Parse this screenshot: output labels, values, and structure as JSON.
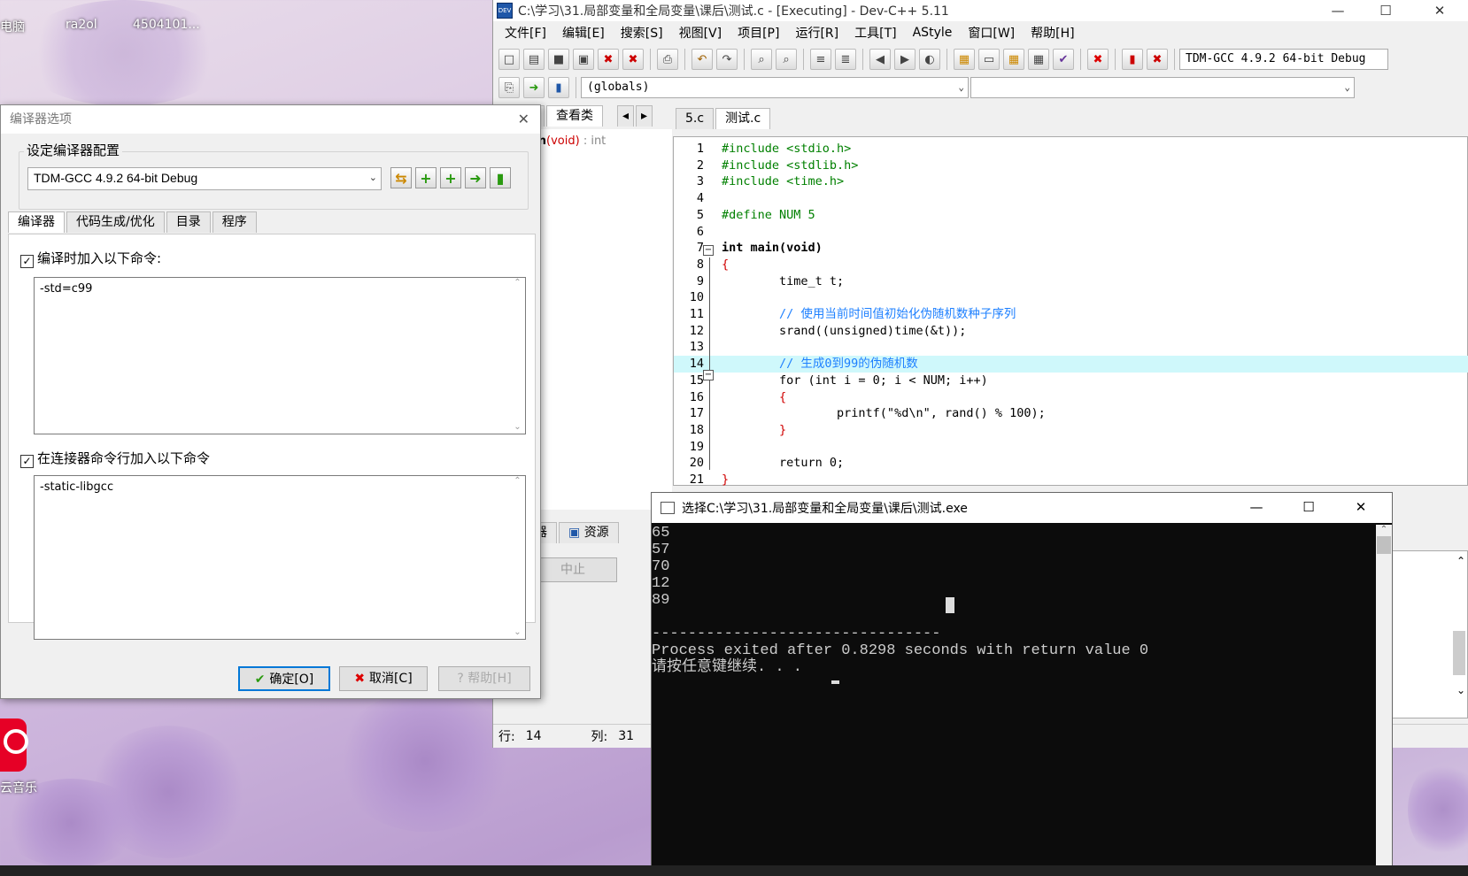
{
  "desktop": {
    "icon_labels": [
      "电脑",
      "ra2ol",
      "4504101..."
    ],
    "netease_label": "云音乐"
  },
  "devcpp": {
    "title": "C:\\学习\\31.局部变量和全局变量\\课后\\测试.c - [Executing] - Dev-C++ 5.11",
    "window_buttons": {
      "minimize": "—",
      "maximize": "☐",
      "close": "✕"
    },
    "menu": [
      "文件[F]",
      "编辑[E]",
      "搜索[S]",
      "视图[V]",
      "项目[P]",
      "运行[R]",
      "工具[T]",
      "AStyle",
      "窗口[W]",
      "帮助[H]"
    ],
    "compiler_select": "TDM-GCC 4.9.2 64-bit Debug",
    "globals_select": "(globals)",
    "left_tabs": [
      "理",
      "查看类"
    ],
    "file_tabs": [
      "5.c",
      "测试.c"
    ],
    "class_item": {
      "name": "main",
      "args": "(void)",
      "ret": " : int"
    },
    "code": [
      {
        "n": "1",
        "t": "#include <stdio.h>",
        "c": "pp"
      },
      {
        "n": "2",
        "t": "#include <stdlib.h>",
        "c": "pp"
      },
      {
        "n": "3",
        "t": "#include <time.h>",
        "c": "pp"
      },
      {
        "n": "4",
        "t": "",
        "c": ""
      },
      {
        "n": "5",
        "t": "#define NUM 5",
        "c": "pp"
      },
      {
        "n": "6",
        "t": "",
        "c": ""
      },
      {
        "n": "7",
        "t": "int main(void)",
        "c": "kw"
      },
      {
        "n": "8",
        "t": "{",
        "c": "sym"
      },
      {
        "n": "9",
        "t": "        time_t t;",
        "c": ""
      },
      {
        "n": "10",
        "t": "",
        "c": ""
      },
      {
        "n": "11",
        "t": "        // 使用当前时间值初始化伪随机数种子序列",
        "c": "cm"
      },
      {
        "n": "12",
        "t": "        srand((unsigned)time(&t));",
        "c": ""
      },
      {
        "n": "13",
        "t": "",
        "c": ""
      },
      {
        "n": "14",
        "t": "        // 生成0到99的伪随机数",
        "c": "cm"
      },
      {
        "n": "15",
        "t": "        for (int i = 0; i < NUM; i++)",
        "c": ""
      },
      {
        "n": "16",
        "t": "        {",
        "c": "sym"
      },
      {
        "n": "17",
        "t": "                printf(\"%d\\n\", rand() % 100);",
        "c": ""
      },
      {
        "n": "18",
        "t": "        }",
        "c": "sym"
      },
      {
        "n": "19",
        "t": "",
        "c": ""
      },
      {
        "n": "20",
        "t": "        return 0;",
        "c": ""
      },
      {
        "n": "21",
        "t": "}",
        "c": "sym"
      }
    ],
    "highlight_line": 14,
    "bottom_tabs": [
      "译器",
      "资源"
    ],
    "abort_button": "中止",
    "status": {
      "row_label": "行:",
      "row": "14",
      "col_label": "列:",
      "col": "31"
    }
  },
  "compiler_dialog": {
    "title": "编译器选项",
    "config_group": "设定编译器配置",
    "config_value": "TDM-GCC 4.9.2 64-bit Debug",
    "tabs": [
      "编译器",
      "代码生成/优化",
      "目录",
      "程序"
    ],
    "compile_check_label": "编译时加入以下命令:",
    "compile_cmd": "-std=c99",
    "linker_check_label": "在连接器命令行加入以下命令",
    "linker_cmd": "-static-libgcc",
    "ok": "确定[O]",
    "cancel": "取消[C]",
    "help": "帮助[H]"
  },
  "console": {
    "title": "选择C:\\学习\\31.局部变量和全局变量\\课后\\测试.exe",
    "lines": [
      "65",
      "57",
      "70",
      "12",
      "89",
      "",
      "--------------------------------",
      "Process exited after 0.8298 seconds with return value 0",
      "请按任意键继续. . . "
    ]
  }
}
